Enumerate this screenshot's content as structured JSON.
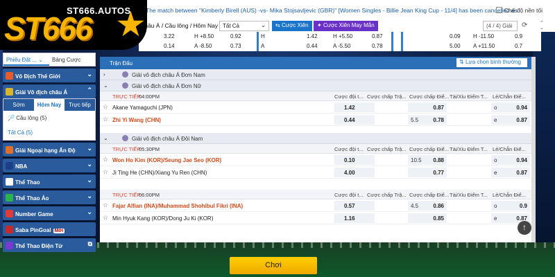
{
  "logo": {
    "sub": "ST666.AUTOS",
    "main": "ST666"
  },
  "notice": {
    "text": "The match between \"Kimberly Birell (AUS) -vs- Mika Stojsavljevic (GBR)\" [Women Singles - Billie Jean King Cup - 11/4] has been cancelled as",
    "hide_label": "Chế độ nền tối"
  },
  "filter": {
    "crumb": "châu Á / Cầu lông / Hôm Nay",
    "select_value": "Tất Cả",
    "parlay_btn": "Cược Xiên",
    "random_parlay_btn": "Cược Xiên May Mắn",
    "pager": "(4 / 4) Giải"
  },
  "parlay_cards": [
    {
      "r1a": "3.22",
      "r1b": "H +8.50",
      "r1c": "0.92",
      "r2a": "0.14",
      "r2b": "A -8.50",
      "r2c": "0.73"
    },
    {
      "r1a": "1.42",
      "r1b": "H +5.50",
      "r1c": "0.87",
      "r2a": "0.44",
      "r2b": "A -5.50",
      "r2c": "0.78"
    },
    {
      "r1a": "0.09",
      "r1b": "H -11.50",
      "r1c": "0.9",
      "r2a": "5.00",
      "r2b": "A +11.50",
      "r2c": "0.7"
    }
  ],
  "card_extra": {
    "h": "H",
    "a": "A"
  },
  "sidebar": {
    "top_tabs": [
      "Phiếu Đặt ...",
      "Bảng Cược"
    ],
    "items": [
      {
        "label": "Vô Địch Thế Giới"
      },
      {
        "label": "Giải Vô địch châu Á"
      }
    ],
    "subtabs": [
      "Sớm",
      "Hôm Nay",
      "Trực tiếp"
    ],
    "sub_items": [
      {
        "label": "Cầu lông",
        "count": "(5)"
      },
      {
        "label": "Tất Cả",
        "count": "(5)"
      }
    ],
    "more_items": [
      {
        "label": "Giải Ngoại hạng Ấn Độ"
      },
      {
        "label": "NBA"
      },
      {
        "label": "Thể Thao"
      },
      {
        "label": "Thể Thao Ảo"
      },
      {
        "label": "Number Game"
      },
      {
        "label": "Saba PinGoal",
        "badge": "Mới"
      },
      {
        "label": "Thể Thao Điện Tử"
      }
    ]
  },
  "main": {
    "header": "Trận Đấu",
    "sort_select": "Lựa chọn bình thường",
    "columns": [
      "Cược đội t...",
      "Cược chấp Trậ...",
      "Cược chấp Điể...",
      "Tài/Xỉu Điểm T...",
      "Lẻ/Chẵn Điể..."
    ],
    "live_label": "TRỰC TIẾP",
    "groups": [
      {
        "title": "Giải vô địch châu Á Đơn Nam",
        "expanded": false
      },
      {
        "title": "Giải vô địch châu Á Đơn Nữ",
        "expanded": true
      },
      {
        "title": "Giải vô địch châu Á Đôi Nam",
        "expanded": true
      }
    ],
    "matches": [
      {
        "time": "04:00PM",
        "rows": [
          {
            "team": "Akane Yamaguchi (JPN)",
            "red": false,
            "ml": "1.42",
            "pt_hc": "",
            "pt": "0.87",
            "oe_l": "o",
            "oe": "0.94"
          },
          {
            "team": "Zhi Yi Wang (CHN)",
            "red": true,
            "ml": "0.44",
            "pt_hc": "5.5",
            "pt": "0.78",
            "oe_l": "e",
            "oe": "0.87"
          }
        ]
      },
      {
        "time": "05:30PM",
        "rows": [
          {
            "team": "Won Ho Kim (KOR)/Seung Jae Seo (KOR)",
            "red": true,
            "ml": "0.10",
            "pt_hc": "10.5",
            "pt": "0.88",
            "oe_l": "o",
            "oe": "0.94"
          },
          {
            "team": "Ji Ting He (CHN)/Xiang Yu Ren (CHN)",
            "red": false,
            "ml": "4.00",
            "pt_hc": "",
            "pt": "0.77",
            "oe_l": "e",
            "oe": "0.87"
          }
        ]
      },
      {
        "time": "06:00PM",
        "rows": [
          {
            "team": "Fajar Alfian (INA)/Muhammad Shohibul Fikri (INA)",
            "red": true,
            "ml": "0.57",
            "pt_hc": "4.5",
            "pt": "0.86",
            "oe_l": "o",
            "oe": "0.9"
          },
          {
            "team": "Min Hyuk Kang (KOR)/Dong Ju Ki (KOR)",
            "red": false,
            "ml": "1.16",
            "pt_hc": "",
            "pt": "0.85",
            "oe_l": "e",
            "oe": "0.87"
          }
        ]
      }
    ]
  },
  "play_button": "Chơi",
  "colors": {
    "accent": "#1a74c9",
    "header_blue": "#2a6fb8",
    "live_red": "#dd4433",
    "gold": "#f7b500"
  }
}
